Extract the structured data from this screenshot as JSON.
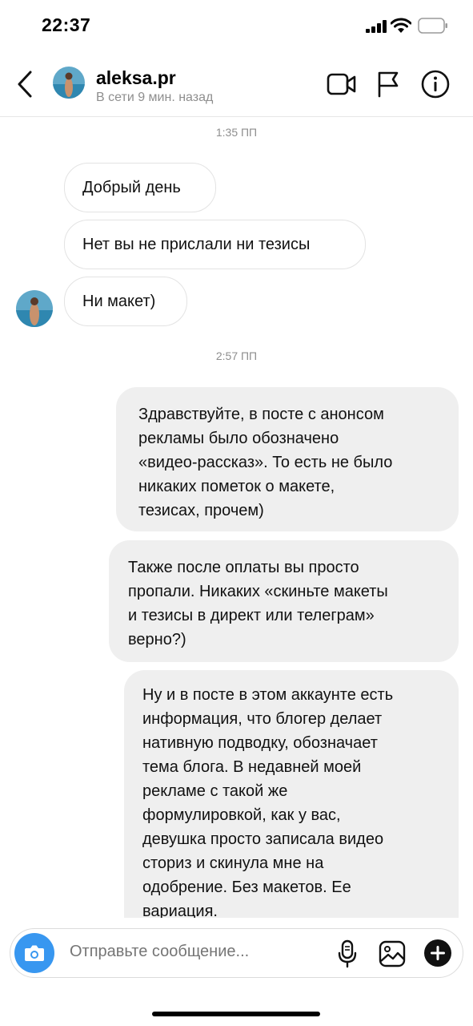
{
  "status_bar": {
    "time": "22:37"
  },
  "header": {
    "username": "aleksa.pr",
    "status": "В сети 9 мин. назад"
  },
  "chat": {
    "timestamps": [
      "1:35 ПП",
      "2:57 ПП"
    ],
    "incoming": [
      "Добрый день",
      "Нет вы не прислали ни тезисы",
      "Ни макет)"
    ],
    "outgoing": [
      [
        "Здравствуйте, в посте с анонсом",
        "рекламы было обозначено",
        "«видео-рассказ». То есть не было",
        "никаких пометок о макете,",
        "тезисах, прочем)"
      ],
      [
        "Также после оплаты вы просто",
        "пропали. Никаких «скиньте макеты",
        "и тезисы в директ или телеграм»",
        "верно?)"
      ],
      [
        "Ну и в посте в этом аккаунте есть",
        "информация, что блогер делает",
        "нативную подводку, обозначает",
        "тема блога. В недавней моей",
        "рекламе с такой же",
        "формулировкой, как у вас,",
        "девушка просто записала видео",
        "сториз и скинула мне на",
        "одобрение. Без макетов. Ее",
        "вариация."
      ]
    ]
  },
  "composer": {
    "placeholder": "Отправьте сообщение..."
  },
  "colors": {
    "accent": "#3897f0",
    "bubble_out": "#efefef",
    "secondary_text": "#8e8e8e"
  }
}
